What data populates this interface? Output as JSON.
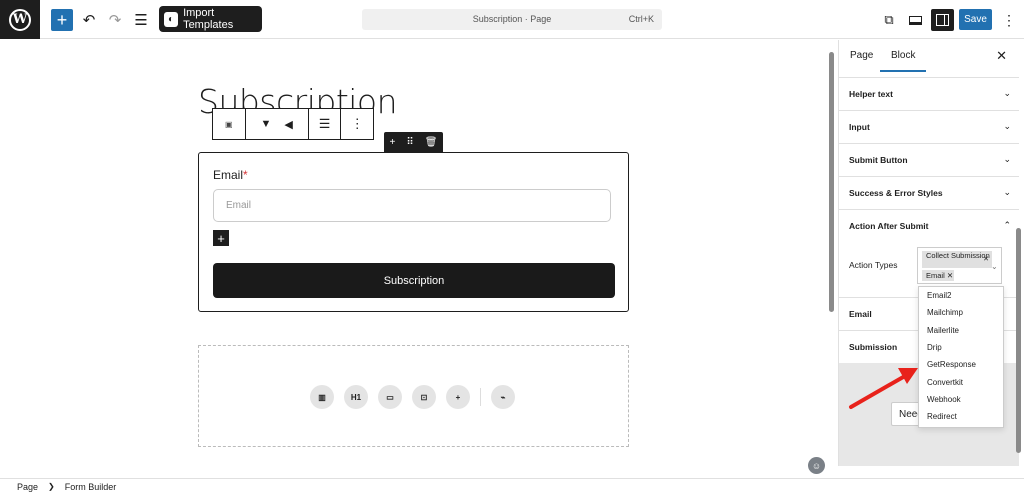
{
  "topbar": {
    "import_label": "Import Templates",
    "command_title": "Subscription · Page",
    "command_shortcut": "Ctrl+K",
    "save_label": "Save"
  },
  "canvas": {
    "page_title": "Subscription",
    "email_label": "Email",
    "required_mark": "*",
    "email_placeholder": "Email",
    "submit_label": "Subscription",
    "heading_icon_label": "H1"
  },
  "sidebar": {
    "tabs": [
      "Page",
      "Block"
    ],
    "panels": [
      "Helper text",
      "Input",
      "Submit Button",
      "Success & Error Styles",
      "Action After Submit",
      "Email",
      "Submission"
    ],
    "action_types_label": "Action Types",
    "selected_tags": [
      "Collect Submission",
      "Email"
    ],
    "dropdown_options": [
      "Email2",
      "Mailchimp",
      "Mailerlite",
      "Drip",
      "GetResponse",
      "Convertkit",
      "Webhook",
      "Redirect"
    ],
    "help_button_label": "Need"
  },
  "footer": {
    "breadcrumb": [
      "Page",
      "Form Builder"
    ]
  },
  "colors": {
    "accent": "#2271b1",
    "dark": "#1e1e1e",
    "annotation_arrow": "#e8221b"
  }
}
